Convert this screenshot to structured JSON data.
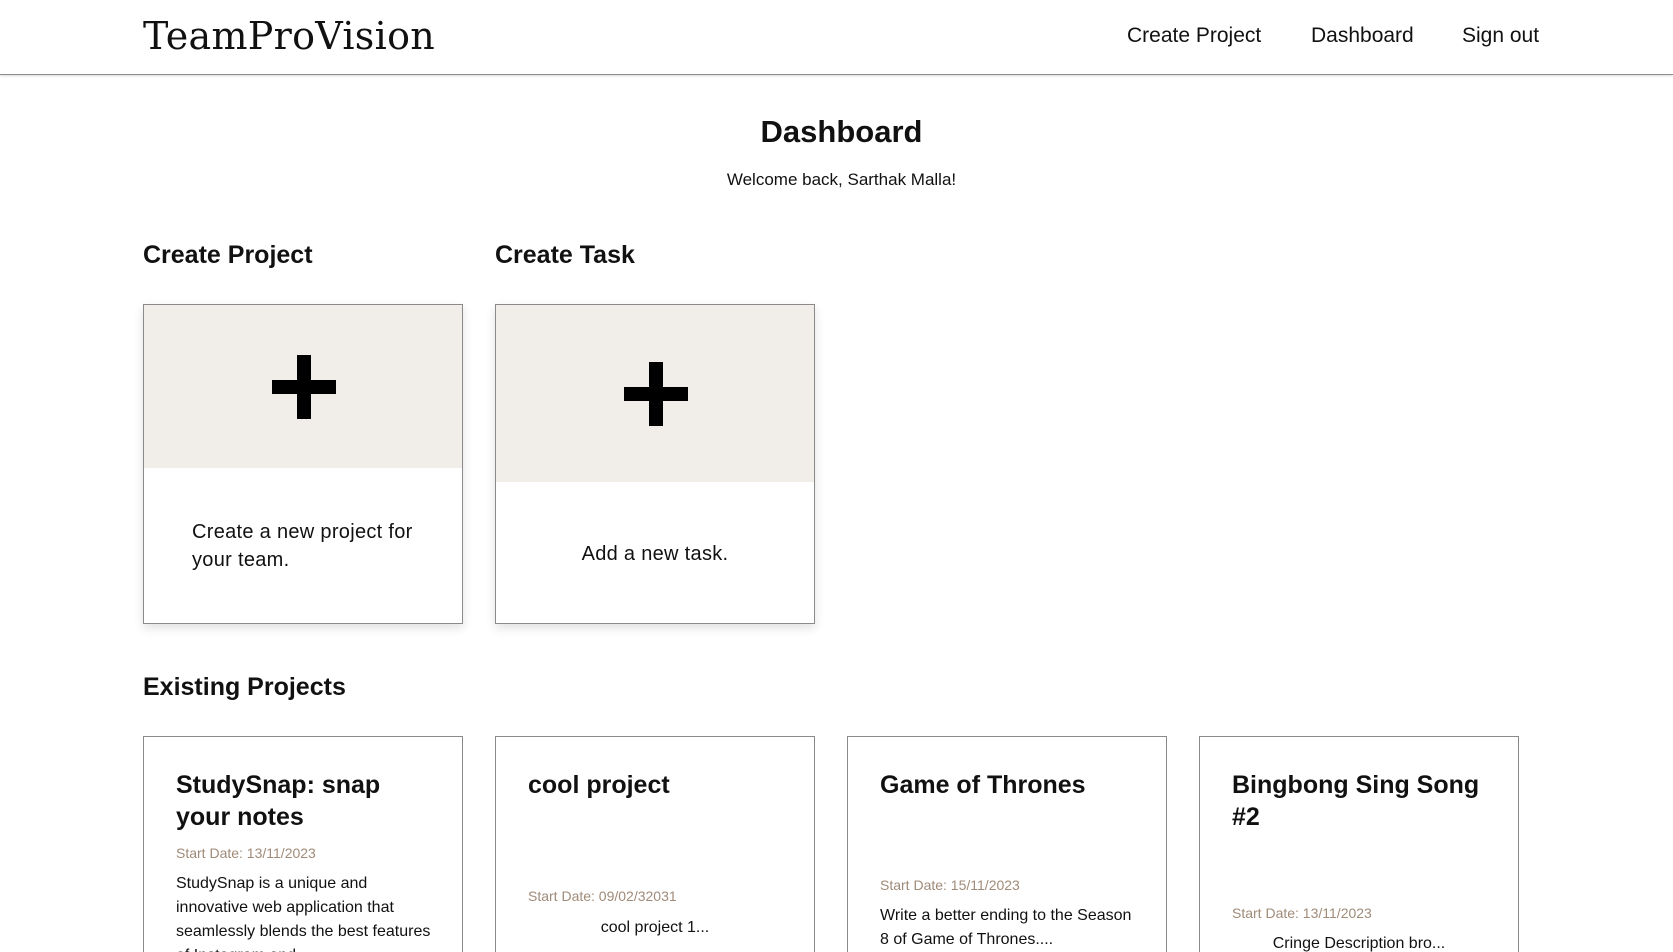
{
  "nav": {
    "brand": "TeamProVision",
    "links": [
      "Create Project",
      "Dashboard",
      "Sign out"
    ]
  },
  "header": {
    "title": "Dashboard",
    "welcome": "Welcome back, Sarthak Malla!"
  },
  "sections": {
    "create_project": "Create Project",
    "create_task": "Create Task",
    "existing_projects": "Existing Projects"
  },
  "create_project_card": {
    "icon": "plus-icon",
    "text": "Create a new project for your team."
  },
  "create_task_card": {
    "icon": "plus-icon",
    "text": "Add a new task."
  },
  "projects": [
    {
      "title": "StudySnap: snap your notes",
      "start_date": "Start Date: 13/11/2023",
      "description": "StudySnap is a unique and innovative web application that seamlessly blends the best features of Instagram and"
    },
    {
      "title": "cool project",
      "start_date": "Start Date: 09/02/32031",
      "description": "cool project 1..."
    },
    {
      "title": "Game of Thrones",
      "start_date": "Start Date: 15/11/2023",
      "description": "Write a better ending to the Season 8 of Game of Thrones...."
    },
    {
      "title": "Bingbong Sing Song #2",
      "start_date": "Start Date: 13/11/2023",
      "description": "Cringe Description bro..."
    }
  ]
}
